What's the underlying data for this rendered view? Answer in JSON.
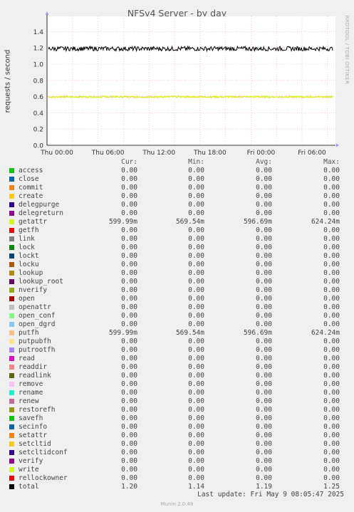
{
  "chart_data": {
    "type": "line",
    "title": "NFSv4 Server - by day",
    "ylabel": "requests / second",
    "ylim": [
      0,
      1.5
    ],
    "yticks": [
      "0.0",
      "0.2",
      "0.4",
      "0.6",
      "0.8",
      "1.0",
      "1.2",
      "1.4"
    ],
    "xticks": [
      "Thu 00:00",
      "Thu 06:00",
      "Thu 12:00",
      "Thu 18:00",
      "Fri 00:00",
      "Fri 06:00"
    ],
    "series": [
      {
        "name": "total",
        "color": "#000000",
        "mean": 1.19,
        "min": 1.14,
        "max": 1.25
      },
      {
        "name": "getattr",
        "color": "#ccff00",
        "mean": 0.5967,
        "min": 0.5695,
        "max": 0.6242
      },
      {
        "name": "putfh",
        "color": "#ffbb88",
        "mean": 0.5967,
        "min": 0.5695,
        "max": 0.6242
      }
    ]
  },
  "watermark": "RRDTOOL / TOBI OETIKER",
  "legend_header": {
    "cur": "Cur:",
    "min": "Min:",
    "avg": "Avg:",
    "max": "Max:"
  },
  "legend": [
    {
      "label": "access",
      "color": "#00cc00",
      "cur": "0.00",
      "min": "0.00",
      "avg": "0.00",
      "max": "0.00"
    },
    {
      "label": "close",
      "color": "#0066b3",
      "cur": "0.00",
      "min": "0.00",
      "avg": "0.00",
      "max": "0.00"
    },
    {
      "label": "commit",
      "color": "#ff8000",
      "cur": "0.00",
      "min": "0.00",
      "avg": "0.00",
      "max": "0.00"
    },
    {
      "label": "create",
      "color": "#ffcc00",
      "cur": "0.00",
      "min": "0.00",
      "avg": "0.00",
      "max": "0.00"
    },
    {
      "label": "delegpurge",
      "color": "#330099",
      "cur": "0.00",
      "min": "0.00",
      "avg": "0.00",
      "max": "0.00"
    },
    {
      "label": "delegreturn",
      "color": "#990099",
      "cur": "0.00",
      "min": "0.00",
      "avg": "0.00",
      "max": "0.00"
    },
    {
      "label": "getattr",
      "color": "#ccff00",
      "cur": "599.99m",
      "min": "569.54m",
      "avg": "596.69m",
      "max": "624.24m"
    },
    {
      "label": "getfh",
      "color": "#ff0000",
      "cur": "0.00",
      "min": "0.00",
      "avg": "0.00",
      "max": "0.00"
    },
    {
      "label": "link",
      "color": "#808080",
      "cur": "0.00",
      "min": "0.00",
      "avg": "0.00",
      "max": "0.00"
    },
    {
      "label": "lock",
      "color": "#008f00",
      "cur": "0.00",
      "min": "0.00",
      "avg": "0.00",
      "max": "0.00"
    },
    {
      "label": "lockt",
      "color": "#00487d",
      "cur": "0.00",
      "min": "0.00",
      "avg": "0.00",
      "max": "0.00"
    },
    {
      "label": "locku",
      "color": "#b35a00",
      "cur": "0.00",
      "min": "0.00",
      "avg": "0.00",
      "max": "0.00"
    },
    {
      "label": "lookup",
      "color": "#b38f00",
      "cur": "0.00",
      "min": "0.00",
      "avg": "0.00",
      "max": "0.00"
    },
    {
      "label": "lookup_root",
      "color": "#6b006b",
      "cur": "0.00",
      "min": "0.00",
      "avg": "0.00",
      "max": "0.00"
    },
    {
      "label": "nverify",
      "color": "#8fb300",
      "cur": "0.00",
      "min": "0.00",
      "avg": "0.00",
      "max": "0.00"
    },
    {
      "label": "open",
      "color": "#b30000",
      "cur": "0.00",
      "min": "0.00",
      "avg": "0.00",
      "max": "0.00"
    },
    {
      "label": "openattr",
      "color": "#bebebe",
      "cur": "0.00",
      "min": "0.00",
      "avg": "0.00",
      "max": "0.00"
    },
    {
      "label": "open_conf",
      "color": "#80ff80",
      "cur": "0.00",
      "min": "0.00",
      "avg": "0.00",
      "max": "0.00"
    },
    {
      "label": "open_dgrd",
      "color": "#80c9ff",
      "cur": "0.00",
      "min": "0.00",
      "avg": "0.00",
      "max": "0.00"
    },
    {
      "label": "putfh",
      "color": "#ffc080",
      "cur": "599.99m",
      "min": "569.54m",
      "avg": "596.69m",
      "max": "624.24m"
    },
    {
      "label": "putpubfh",
      "color": "#ffe680",
      "cur": "0.00",
      "min": "0.00",
      "avg": "0.00",
      "max": "0.00"
    },
    {
      "label": "putrootfh",
      "color": "#aa80ff",
      "cur": "0.00",
      "min": "0.00",
      "avg": "0.00",
      "max": "0.00"
    },
    {
      "label": "read",
      "color": "#ee00cc",
      "cur": "0.00",
      "min": "0.00",
      "avg": "0.00",
      "max": "0.00"
    },
    {
      "label": "readdir",
      "color": "#ff8080",
      "cur": "0.00",
      "min": "0.00",
      "avg": "0.00",
      "max": "0.00"
    },
    {
      "label": "readlink",
      "color": "#666600",
      "cur": "0.00",
      "min": "0.00",
      "avg": "0.00",
      "max": "0.00"
    },
    {
      "label": "remove",
      "color": "#ffbfff",
      "cur": "0.00",
      "min": "0.00",
      "avg": "0.00",
      "max": "0.00"
    },
    {
      "label": "rename",
      "color": "#00ffcc",
      "cur": "0.00",
      "min": "0.00",
      "avg": "0.00",
      "max": "0.00"
    },
    {
      "label": "renew",
      "color": "#cc6699",
      "cur": "0.00",
      "min": "0.00",
      "avg": "0.00",
      "max": "0.00"
    },
    {
      "label": "restorefh",
      "color": "#999900",
      "cur": "0.00",
      "min": "0.00",
      "avg": "0.00",
      "max": "0.00"
    },
    {
      "label": "savefh",
      "color": "#00cc00",
      "cur": "0.00",
      "min": "0.00",
      "avg": "0.00",
      "max": "0.00"
    },
    {
      "label": "secinfo",
      "color": "#0066b3",
      "cur": "0.00",
      "min": "0.00",
      "avg": "0.00",
      "max": "0.00"
    },
    {
      "label": "setattr",
      "color": "#ff8000",
      "cur": "0.00",
      "min": "0.00",
      "avg": "0.00",
      "max": "0.00"
    },
    {
      "label": "setcltid",
      "color": "#ffcc00",
      "cur": "0.00",
      "min": "0.00",
      "avg": "0.00",
      "max": "0.00"
    },
    {
      "label": "setcltidconf",
      "color": "#330099",
      "cur": "0.00",
      "min": "0.00",
      "avg": "0.00",
      "max": "0.00"
    },
    {
      "label": "verify",
      "color": "#990099",
      "cur": "0.00",
      "min": "0.00",
      "avg": "0.00",
      "max": "0.00"
    },
    {
      "label": "write",
      "color": "#ccff00",
      "cur": "0.00",
      "min": "0.00",
      "avg": "0.00",
      "max": "0.00"
    },
    {
      "label": "rellockowner",
      "color": "#ff0000",
      "cur": "0.00",
      "min": "0.00",
      "avg": "0.00",
      "max": "0.00"
    },
    {
      "label": "total",
      "color": "#000000",
      "cur": "1.20",
      "min": "1.14",
      "avg": "1.19",
      "max": "1.25"
    }
  ],
  "last_update": "Last update: Fri May  9 08:05:47 2025",
  "footer": "Munin 2.0.49"
}
